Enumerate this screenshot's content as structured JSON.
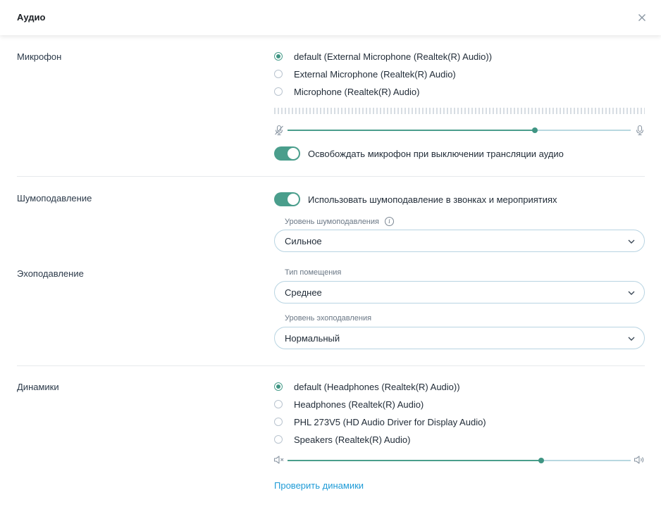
{
  "header": {
    "title": "Аудио"
  },
  "microphone": {
    "label": "Микрофон",
    "options": [
      "default (External Microphone (Realtek(R) Audio))",
      "External Microphone (Realtek(R) Audio)",
      "Microphone (Realtek(R) Audio)"
    ],
    "selected_index": 0,
    "volume_percent": 72,
    "release_toggle_label": "Освобождать микрофон при выключении трансляции аудио",
    "release_toggle_on": true
  },
  "noise": {
    "label": "Шумоподавление",
    "toggle_label": "Использовать шумоподавление в звонках и мероприятиях",
    "toggle_on": true,
    "level_label": "Уровень шумоподавления",
    "level_value": "Сильное"
  },
  "echo": {
    "label": "Эхоподавление",
    "room_label": "Тип помещения",
    "room_value": "Среднее",
    "level_label": "Уровень эхоподавления",
    "level_value": "Нормальный"
  },
  "speakers": {
    "label": "Динамики",
    "options": [
      "default (Headphones (Realtek(R) Audio))",
      "Headphones (Realtek(R) Audio)",
      "PHL 273V5 (HD Audio Driver for Display Audio)",
      "Speakers (Realtek(R) Audio)"
    ],
    "selected_index": 0,
    "volume_percent": 74,
    "test_link": "Проверить динамики"
  },
  "colors": {
    "accent": "#4a9e8c",
    "link": "#1e9bd7"
  },
  "icons": {
    "close": "close-icon",
    "mic_muted": "mic-muted-icon",
    "mic": "mic-icon",
    "speaker_muted": "speaker-muted-icon",
    "speaker": "speaker-icon",
    "info": "info-icon",
    "chevron": "chevron-down-icon"
  }
}
